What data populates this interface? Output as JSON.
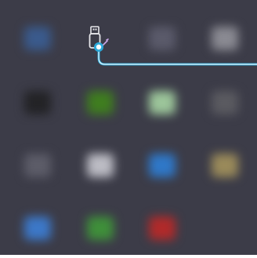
{
  "desktop": {
    "background": "#3c3c48",
    "tiles": [
      {
        "color": "#3a5a8c",
        "icon": "blurred-app-icon"
      },
      {
        "color": "#5a5a6a",
        "icon": "blurred-app-icon"
      },
      {
        "color": "#8a8a92",
        "icon": "blurred-app-icon"
      },
      {
        "color": "#232326",
        "icon": "blurred-app-icon"
      },
      {
        "color": "#3f7d1f",
        "icon": "blurred-app-icon"
      },
      {
        "color": "#9cc59a",
        "icon": "blurred-app-icon"
      },
      {
        "color": "#5a5a60",
        "icon": "blurred-app-icon"
      },
      {
        "color": "#5c5c68",
        "icon": "blurred-app-icon"
      },
      {
        "color": "#bcbcc4",
        "icon": "blurred-app-icon"
      },
      {
        "color": "#2f78c8",
        "icon": "blurred-app-icon"
      },
      {
        "color": "#9a8a5a",
        "icon": "blurred-app-icon"
      },
      {
        "color": "#3c78c8",
        "icon": "blurred-app-icon"
      },
      {
        "color": "#3f8f3a",
        "icon": "blurred-app-icon"
      },
      {
        "color": "#b02a2a",
        "icon": "blurred-app-icon"
      }
    ]
  },
  "highlight": {
    "icon": "usb-drive-icon",
    "callout_color": "#2aa8d8"
  }
}
